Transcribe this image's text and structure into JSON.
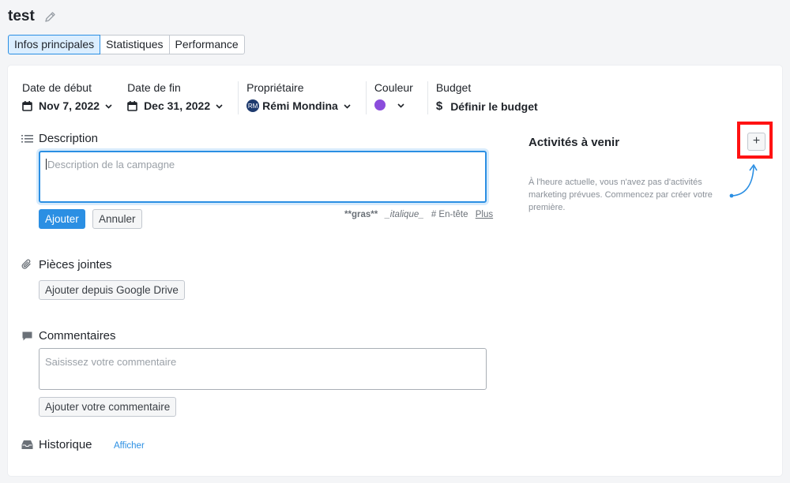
{
  "header": {
    "title": "test"
  },
  "tabs": [
    {
      "label": "Infos principales",
      "active": true
    },
    {
      "label": "Statistiques",
      "active": false
    },
    {
      "label": "Performance",
      "active": false
    }
  ],
  "meta": {
    "start": {
      "label": "Date de début",
      "value": "Nov 7, 2022"
    },
    "end": {
      "label": "Date de fin",
      "value": "Dec 31, 2022"
    },
    "owner": {
      "label": "Propriétaire",
      "initials": "RM",
      "value": "Rémi Mondina"
    },
    "color": {
      "label": "Couleur",
      "value": "#8b4ddc"
    },
    "budget": {
      "label": "Budget",
      "symbol": "$",
      "value": "Définir le budget"
    }
  },
  "description": {
    "title": "Description",
    "placeholder": "Description de la campagne",
    "add_label": "Ajouter",
    "cancel_label": "Annuler",
    "hints": {
      "bold": "**gras**",
      "italic": "_italique_",
      "heading": "# En-tête",
      "more": "Plus"
    }
  },
  "attachments": {
    "title": "Pièces jointes",
    "button_label": "Ajouter depuis Google Drive"
  },
  "comments": {
    "title": "Commentaires",
    "placeholder": "Saisissez votre commentaire",
    "button_label": "Ajouter votre commentaire"
  },
  "history": {
    "title": "Historique",
    "link_label": "Afficher"
  },
  "activities": {
    "title": "Activités à venir",
    "add_label": "+",
    "empty_text": "À l'heure actuelle, vous n'avez pas d'activités marketing prévues. Commencez par créer votre première."
  },
  "colors": {
    "accent": "#2b8fe3",
    "highlight": "#ff1212",
    "swatch": "#8b4ddc"
  }
}
